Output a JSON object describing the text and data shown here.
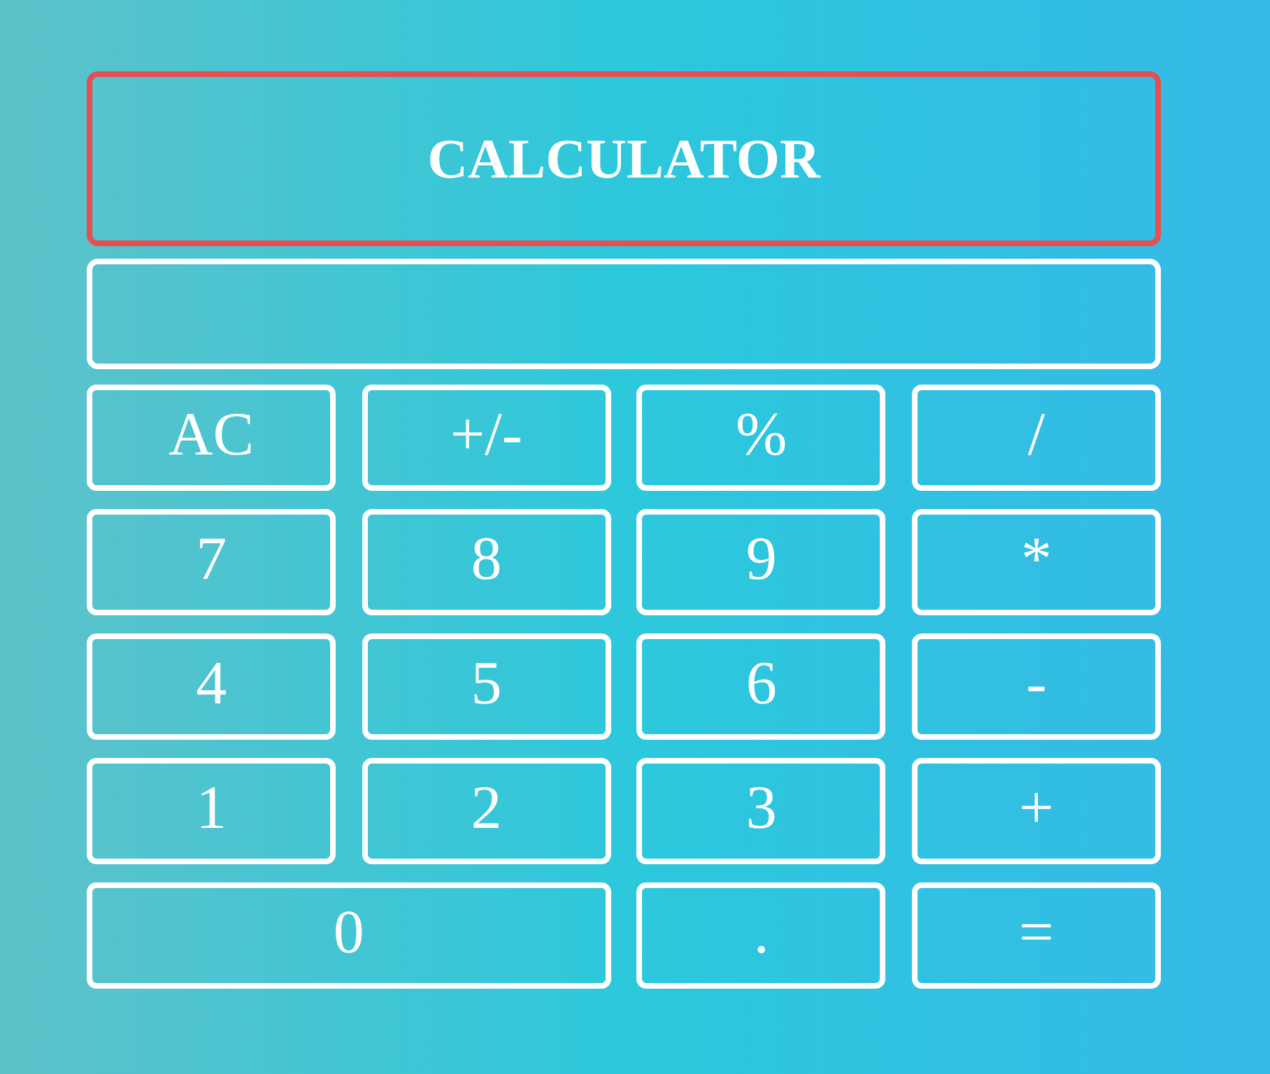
{
  "title": "CALCULATOR",
  "keys": [
    {
      "label": "AC",
      "kind": "key"
    },
    {
      "label": "+/-",
      "kind": "key"
    },
    {
      "label": "%",
      "kind": "key"
    },
    {
      "label": "/",
      "kind": "key"
    },
    {
      "label": "7",
      "kind": "key"
    },
    {
      "label": "8",
      "kind": "key"
    },
    {
      "label": "9",
      "kind": "key"
    },
    {
      "label": "*",
      "kind": "key"
    },
    {
      "label": "4",
      "kind": "key"
    },
    {
      "label": "5",
      "kind": "key"
    },
    {
      "label": "6",
      "kind": "key"
    },
    {
      "label": "-",
      "kind": "key"
    },
    {
      "label": "1",
      "kind": "key"
    },
    {
      "label": "2",
      "kind": "key"
    },
    {
      "label": "3",
      "kind": "key"
    },
    {
      "label": "+",
      "kind": "key"
    },
    {
      "label": "0",
      "kind": "wide"
    },
    {
      "label": ".",
      "kind": "key"
    },
    {
      "label": "=",
      "kind": "key"
    }
  ]
}
